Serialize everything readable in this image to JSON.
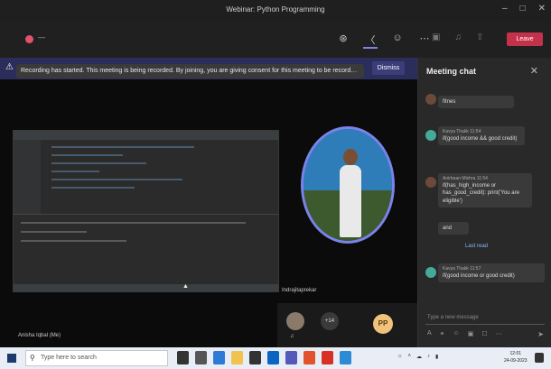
{
  "window": {
    "title": "Webinar: Python Programming",
    "controls": [
      "–",
      "□",
      "✕"
    ]
  },
  "meeting_bar": {
    "timer": "—",
    "icons": [
      "people-icon",
      "chat-icon",
      "reactions-icon",
      "more-icon",
      "camera-icon",
      "mic-icon",
      "share-icon"
    ],
    "leave_label": "Leave"
  },
  "banner": {
    "icon": "⚠",
    "message": "Recording has started. This meeting is being recorded. By joining, you are giving consent for this meeting to be recorded. Priv...",
    "dismiss_label": "Dismiss"
  },
  "stage": {
    "presenter_label": "Anisha Iqbal (Me)",
    "sharer_label": "Indrajitaprekar"
  },
  "participants": {
    "more_label": "+14",
    "pp_initials": "PP"
  },
  "chat": {
    "title": "Meeting chat",
    "messages": [
      {
        "author": "",
        "time": "",
        "text": "fitnes"
      },
      {
        "author": "Kavya Thakk",
        "time": "11:54",
        "text": "if(good income && good credit)"
      },
      {
        "author": "Anirbaan Mishra",
        "time": "11:54",
        "text": "if(has_high_income or has_good_credit): print('You are eligible')"
      },
      {
        "author": "",
        "time": "",
        "text": "and"
      },
      {
        "author": "Kavya Thakk",
        "time": "11:57",
        "text": "if(good income or good credit)"
      }
    ],
    "last_read_label": "Last read",
    "compose_placeholder": "Type a new message"
  },
  "taskbar": {
    "search_placeholder": "Type here to search",
    "time": "12:01",
    "date": "24-09-2023"
  },
  "colors": {
    "accent": "#7b83eb",
    "leave": "#c4314b",
    "banner": "#2b2d5a",
    "recording_dot": "#e2526a"
  }
}
